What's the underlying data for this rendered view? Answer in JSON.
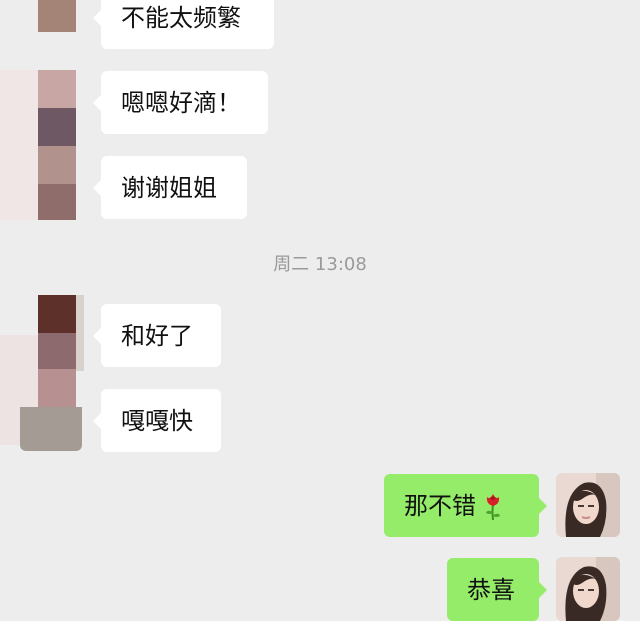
{
  "messages": {
    "m1": {
      "text": "不能太频繁"
    },
    "m2": {
      "text": "嗯嗯好滴！"
    },
    "m3": {
      "text": "谢谢姐姐"
    },
    "m4": {
      "text": "和好了"
    },
    "m5": {
      "text": "嘎嘎快"
    },
    "m6": {
      "text": "那不错"
    },
    "m7": {
      "text": "恭喜"
    }
  },
  "timestamp": "周二 13:08",
  "colors": {
    "background": "#ededed",
    "incoming_bubble": "#ffffff",
    "outgoing_bubble": "#95ec69",
    "timestamp_text": "#9a9a9a"
  },
  "icons": {
    "rose": "rose-icon"
  }
}
